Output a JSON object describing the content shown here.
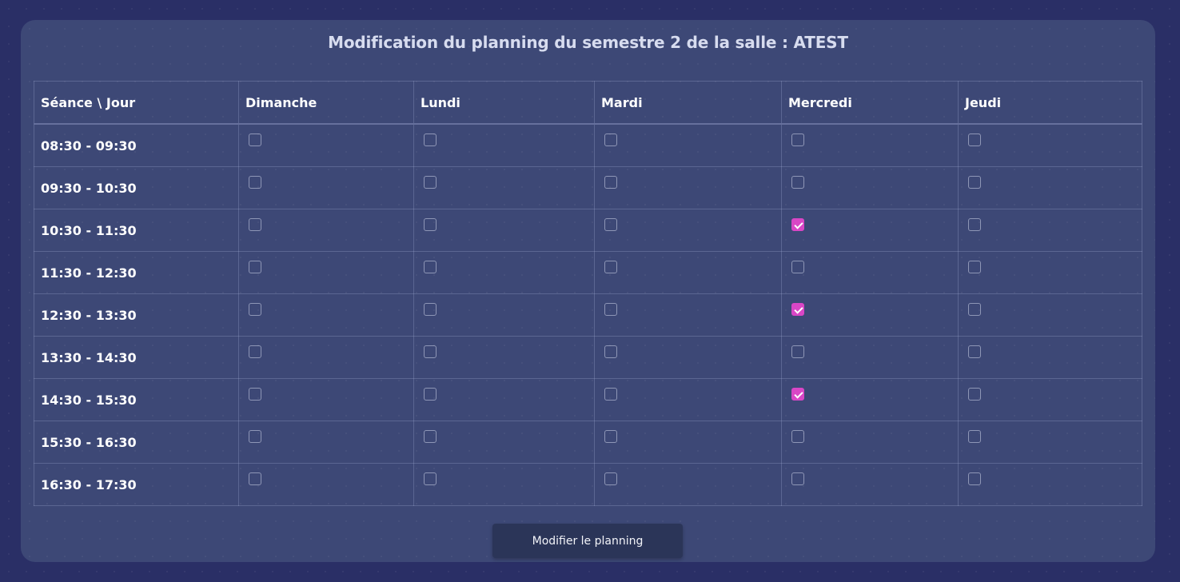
{
  "title": "Modification du planning du semestre 2 de la salle : ATEST",
  "table": {
    "corner_label": "Séance \\ Jour",
    "days": [
      "Dimanche",
      "Lundi",
      "Mardi",
      "Mercredi",
      "Jeudi"
    ],
    "rows": [
      {
        "time": "08:30 - 09:30",
        "checked": [
          false,
          false,
          false,
          false,
          false
        ]
      },
      {
        "time": "09:30 - 10:30",
        "checked": [
          false,
          false,
          false,
          false,
          false
        ]
      },
      {
        "time": "10:30 - 11:30",
        "checked": [
          false,
          false,
          false,
          true,
          false
        ]
      },
      {
        "time": "11:30 - 12:30",
        "checked": [
          false,
          false,
          false,
          false,
          false
        ]
      },
      {
        "time": "12:30 - 13:30",
        "checked": [
          false,
          false,
          false,
          true,
          false
        ]
      },
      {
        "time": "13:30 - 14:30",
        "checked": [
          false,
          false,
          false,
          false,
          false
        ]
      },
      {
        "time": "14:30 - 15:30",
        "checked": [
          false,
          false,
          false,
          true,
          false
        ]
      },
      {
        "time": "15:30 - 16:30",
        "checked": [
          false,
          false,
          false,
          false,
          false
        ]
      },
      {
        "time": "16:30 - 17:30",
        "checked": [
          false,
          false,
          false,
          false,
          false
        ]
      }
    ]
  },
  "submit_label": "Modifier le planning",
  "colors": {
    "page_background": "#2a2f66",
    "card_background": "#3d4876",
    "checkbox_checked": "#d946c6",
    "button_background": "#2b3558"
  }
}
